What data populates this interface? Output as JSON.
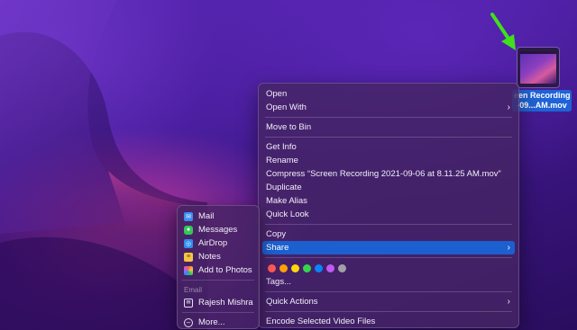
{
  "desktop": {
    "file": {
      "label_line1": "een Recording",
      "label_line2": "-09...AM.mov"
    }
  },
  "context_menu": {
    "items": [
      {
        "label": "Open"
      },
      {
        "label": "Open With",
        "submenu": true
      },
      {
        "label": "Move to Bin"
      },
      {
        "label": "Get Info"
      },
      {
        "label": "Rename"
      },
      {
        "label": "Compress “Screen Recording 2021-09-06 at 8.11.25 AM.mov”"
      },
      {
        "label": "Duplicate"
      },
      {
        "label": "Make Alias"
      },
      {
        "label": "Quick Look"
      },
      {
        "label": "Copy"
      },
      {
        "label": "Share",
        "submenu": true,
        "highlighted": true
      },
      {
        "label": "Tags..."
      },
      {
        "label": "Quick Actions",
        "submenu": true
      },
      {
        "label": "Encode Selected Video Files"
      }
    ],
    "tag_colors": [
      "#ff5b57",
      "#ff9f0a",
      "#ffd60a",
      "#32d74b",
      "#0a84ff",
      "#bf5af2",
      "#a0a0a5"
    ]
  },
  "share_menu": {
    "items": [
      {
        "label": "Mail",
        "icon": "mail-icon",
        "color": "#3b8ef0"
      },
      {
        "label": "Messages",
        "icon": "messages-icon",
        "color": "#34c759"
      },
      {
        "label": "AirDrop",
        "icon": "airdrop-icon",
        "color": "#2f8cf0"
      },
      {
        "label": "Notes",
        "icon": "notes-icon",
        "color": "#f5c542"
      },
      {
        "label": "Add to Photos",
        "icon": "photos-icon",
        "color": "#f06a3a"
      }
    ],
    "email_header": "Email",
    "contact": {
      "label": "Rajesh Mishra",
      "icon": "contact-mail-icon"
    },
    "more": {
      "label": "More...",
      "icon": "more-icon"
    }
  },
  "colors": {
    "highlight": "#1c5fcf",
    "arrow": "#3fe01c"
  }
}
